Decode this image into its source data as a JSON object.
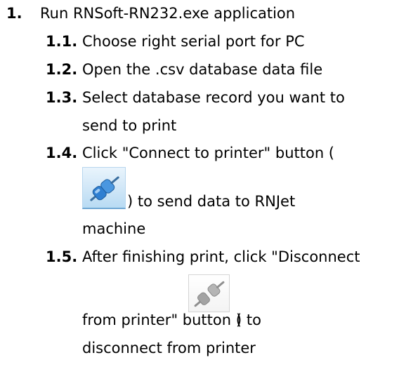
{
  "list": {
    "item1": {
      "number": "1.",
      "text": "Run RNSoft-RN232.exe application"
    },
    "sub": [
      {
        "number": "1.1.",
        "lines": [
          "Choose right serial port for PC"
        ]
      },
      {
        "number": "1.2.",
        "lines": [
          "Open the .csv database data file"
        ]
      },
      {
        "number": "1.3.",
        "lines": [
          "Select database record you want to",
          "send to print"
        ]
      },
      {
        "number": "1.4.",
        "lines": [
          "Click \"Connect to printer\" button (",
          ") to send data to RNJet",
          "machine"
        ]
      },
      {
        "number": "1.5.",
        "lines": [
          "After finishing print, click \"Disconnect",
          "from printer\" button (",
          ") to",
          "disconnect from printer"
        ]
      }
    ]
  },
  "icons": {
    "connect": "connect-plug-icon",
    "disconnect": "disconnect-plug-icon"
  },
  "colors": {
    "text": "#000000",
    "connect_icon_blue": "#2f7fd1",
    "disconnect_icon_gray": "#9a9a9a"
  }
}
